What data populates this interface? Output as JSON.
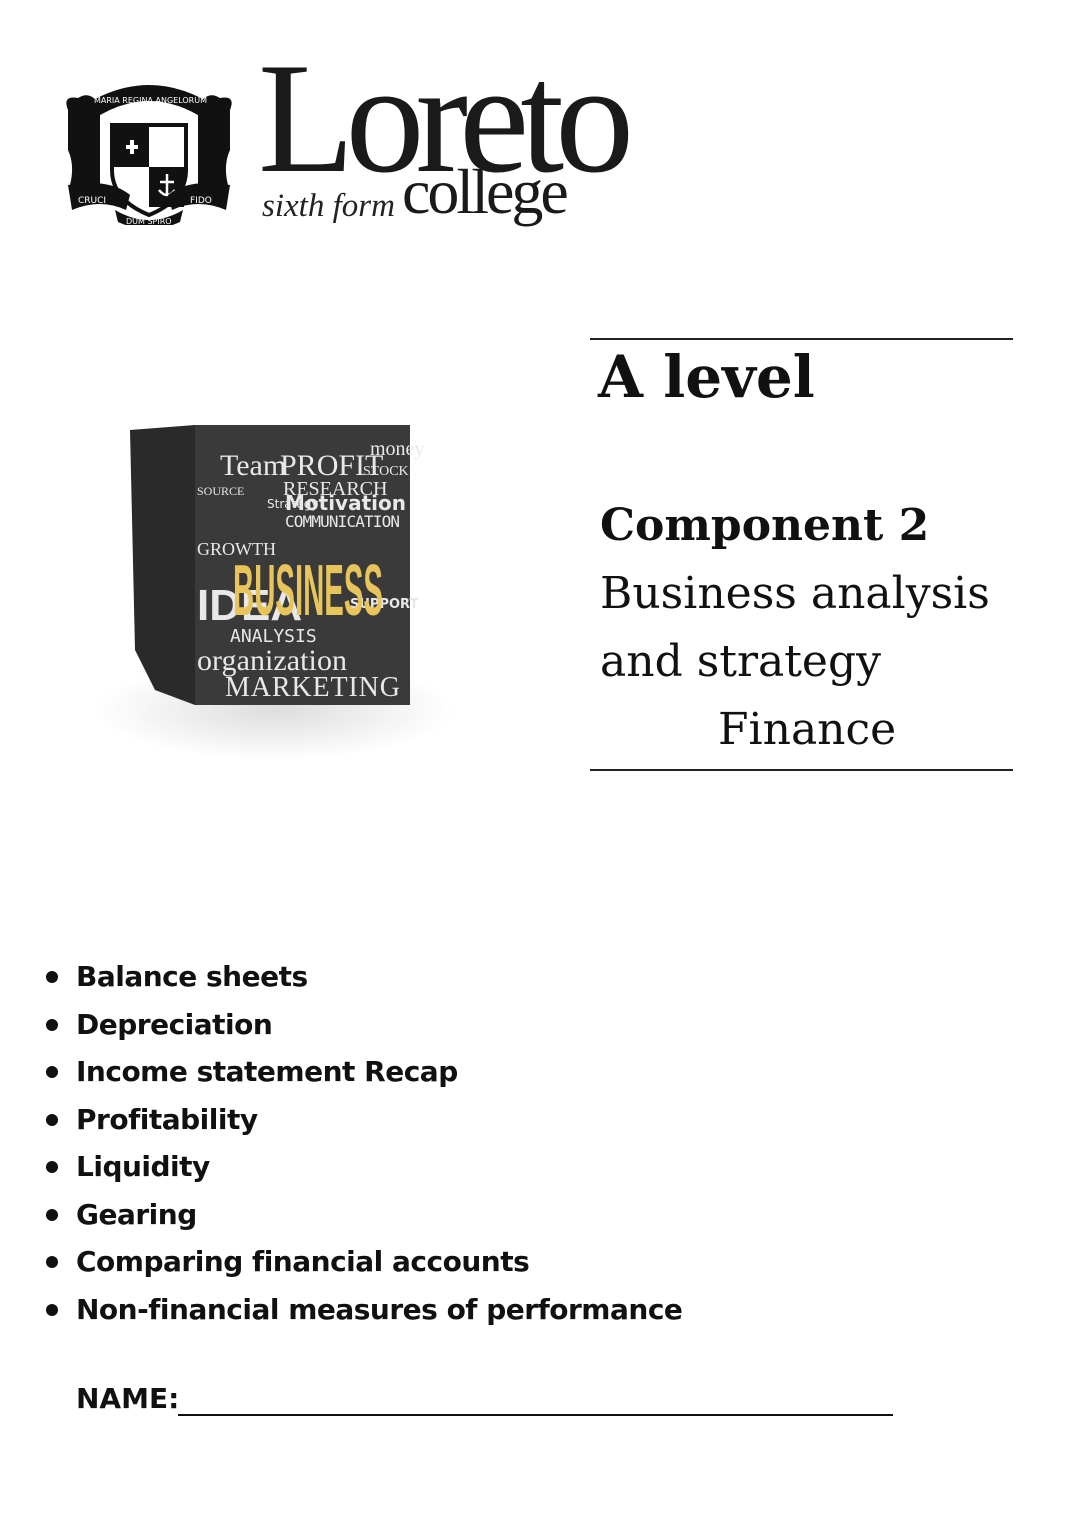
{
  "logo": {
    "crest_motto_top": "MARIA REGINA ANGELORUM",
    "crest_motto_left": "CRUCI",
    "crest_motto_bottom": "DUM SPIRO",
    "crest_motto_right": "FIDO",
    "wordmark": "Loreto",
    "tagline_italic": "sixth form",
    "tagline": "college"
  },
  "cover_image": {
    "words": [
      "Team",
      "PROFIT",
      "STOCK",
      "money",
      "SOURCE",
      "RESEARCH",
      "Strategy",
      "Motivation",
      "COMMUNICATION",
      "BUSINESS",
      "IDEA",
      "GROWTH",
      "SUPPORT",
      "ANALYSIS",
      "organization",
      "MARKETING"
    ],
    "highlight_color": "#e8c55a"
  },
  "title": {
    "level": "A level",
    "component": "Component 2",
    "subtitle_line1": "Business analysis",
    "subtitle_line2": "and strategy",
    "topic": "Finance"
  },
  "topics": [
    "Balance sheets",
    "Depreciation",
    "Income statement Recap",
    "Profitability",
    "Liquidity",
    "Gearing",
    "Comparing financial accounts",
    "Non-financial measures of performance"
  ],
  "name_field": {
    "label": "NAME:",
    "value": ""
  }
}
